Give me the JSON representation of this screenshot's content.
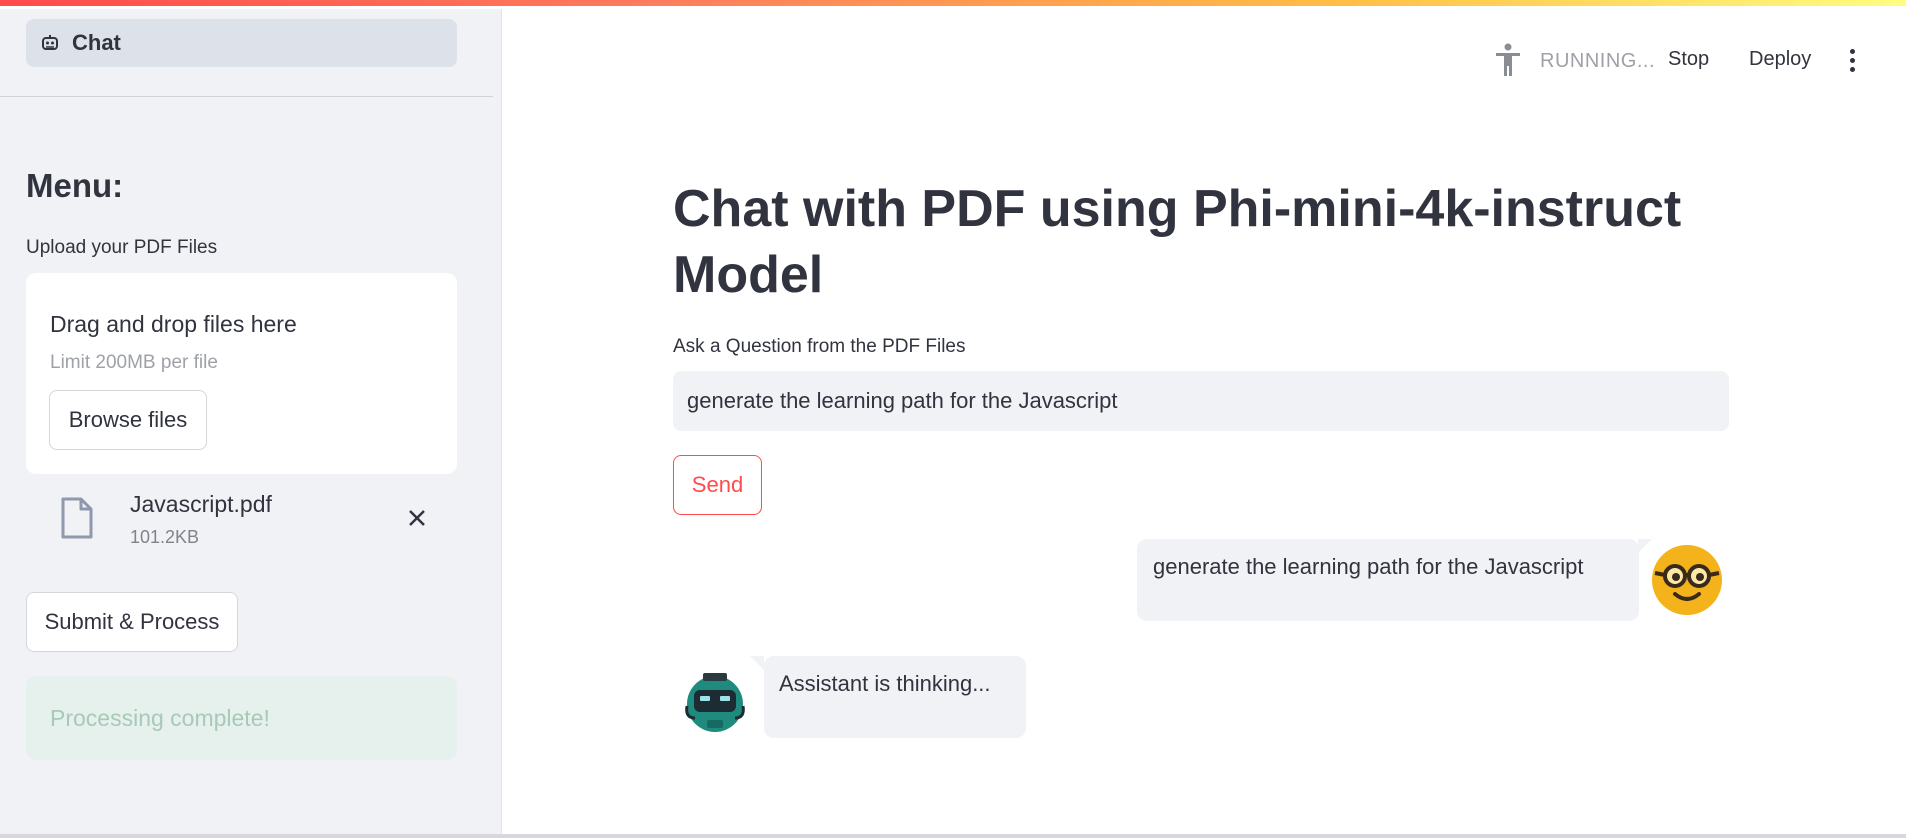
{
  "sidebar": {
    "nav": {
      "label": "Chat",
      "icon": "robot-icon"
    },
    "menu_title": "Menu:",
    "upload_label": "Upload your PDF Files",
    "dropzone": {
      "title": "Drag and drop files here",
      "limit": "Limit 200MB per file",
      "browse_label": "Browse files"
    },
    "file": {
      "name": "Javascript.pdf",
      "size": "101.2KB",
      "icon": "file-icon"
    },
    "submit_label": "Submit & Process",
    "status": "Processing complete!"
  },
  "header": {
    "running": "RUNNING...",
    "stop_label": "Stop",
    "deploy_label": "Deploy"
  },
  "main": {
    "title": "Chat with PDF using Phi-mini-4k-instruct Model",
    "ask_label": "Ask a Question from the PDF Files",
    "ask_value": "generate the learning path for the Javascript",
    "send_label": "Send",
    "messages": [
      {
        "role": "user",
        "text": "generate the learning path for the Javascript",
        "avatar": "nerd-face-icon"
      },
      {
        "role": "assistant",
        "text": "Assistant is thinking...",
        "avatar": "robot-avatar-icon"
      }
    ]
  },
  "colors": {
    "accent": "#ff4b4b",
    "sidebar_bg": "#f0f2f6",
    "text": "#31333f",
    "success_bg": "#e6f1ed"
  }
}
